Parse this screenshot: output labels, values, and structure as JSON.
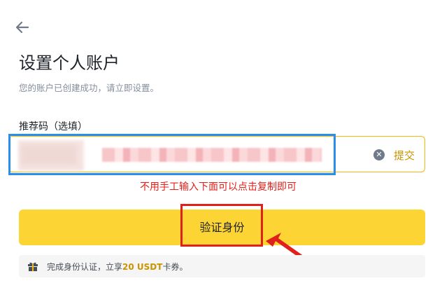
{
  "header": {
    "back_icon": "arrow-left-icon",
    "title": "设置个人账户",
    "subtitle": "您的账户已创建成功，请立即设置。"
  },
  "referral": {
    "label": "推荐码（选填）",
    "clear_icon": "clear-circle-icon",
    "submit_label": "提交"
  },
  "annotation": {
    "text": "不用手工输入下面可以点击复制即可",
    "color": "#e0201a"
  },
  "verify": {
    "button_label": "验证身份",
    "button_color": "#fcd535"
  },
  "promo": {
    "icon": "gift-icon",
    "text_before": "完成身份认证，立享",
    "amount": "20 USDT",
    "text_after": "卡券。"
  },
  "colors": {
    "accent": "#f0b90b",
    "highlight_blue": "#2b8ee8",
    "annotation_red": "#e0201a",
    "muted_text": "#848e9c"
  }
}
